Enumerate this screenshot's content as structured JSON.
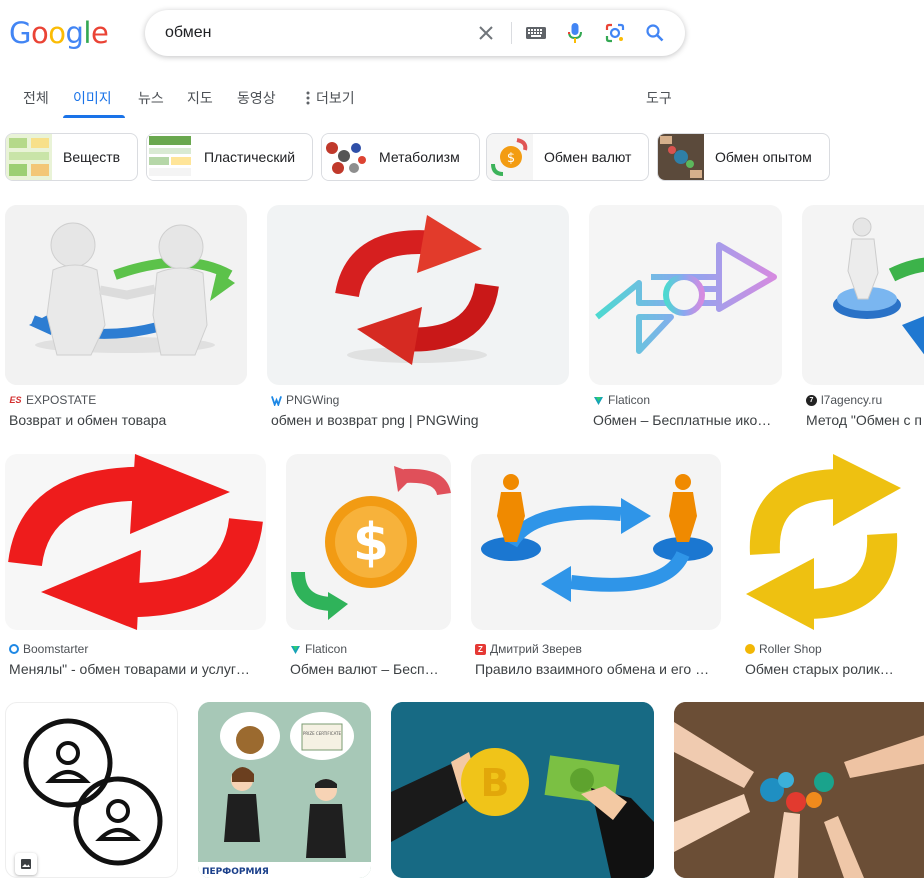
{
  "logo": {
    "letters": [
      "G",
      "o",
      "o",
      "g",
      "l",
      "e"
    ],
    "colors": [
      "#4285f4",
      "#ea4335",
      "#fbbc05",
      "#4285f4",
      "#34a853",
      "#ea4335"
    ]
  },
  "search": {
    "query": "обмен"
  },
  "tabs": [
    {
      "label": "전체"
    },
    {
      "label": "이미지"
    },
    {
      "label": "뉴스"
    },
    {
      "label": "지도"
    },
    {
      "label": "동영상"
    },
    {
      "label": "더보기"
    }
  ],
  "tools_label": "도구",
  "chips": [
    {
      "label": "Веществ"
    },
    {
      "label": "Пластический"
    },
    {
      "label": "Метаболизм"
    },
    {
      "label": "Обмен валют"
    },
    {
      "label": "Обмен опытом"
    }
  ],
  "results": [
    {
      "source": "EXPOSTATE",
      "title": "Возврат и обмен товара"
    },
    {
      "source": "PNGWing",
      "title": "обмен и возврат png | PNGWing"
    },
    {
      "source": "Flaticon",
      "title": "Обмен – Бесплатные ико…"
    },
    {
      "source": "l7agency.ru",
      "title": "Метод \"Обмен с п"
    },
    {
      "source": "Boomstarter",
      "title": "Менялы\" - обмен товарами и услуг…"
    },
    {
      "source": "Flaticon",
      "title": "Обмен валют – Бесп…"
    },
    {
      "source": "Дмитрий Зверев",
      "title": "Правило взаимного обмена и его …"
    },
    {
      "source": "Roller Shop",
      "title": "Обмен старых ролик…"
    }
  ],
  "image_text": {
    "performia": "ПЕРФОРМИЯ",
    "certificate": "PRIZE CERTIFICATE"
  },
  "colors": {
    "accent": "#1a73e8",
    "text_secondary": "#4d5156"
  }
}
